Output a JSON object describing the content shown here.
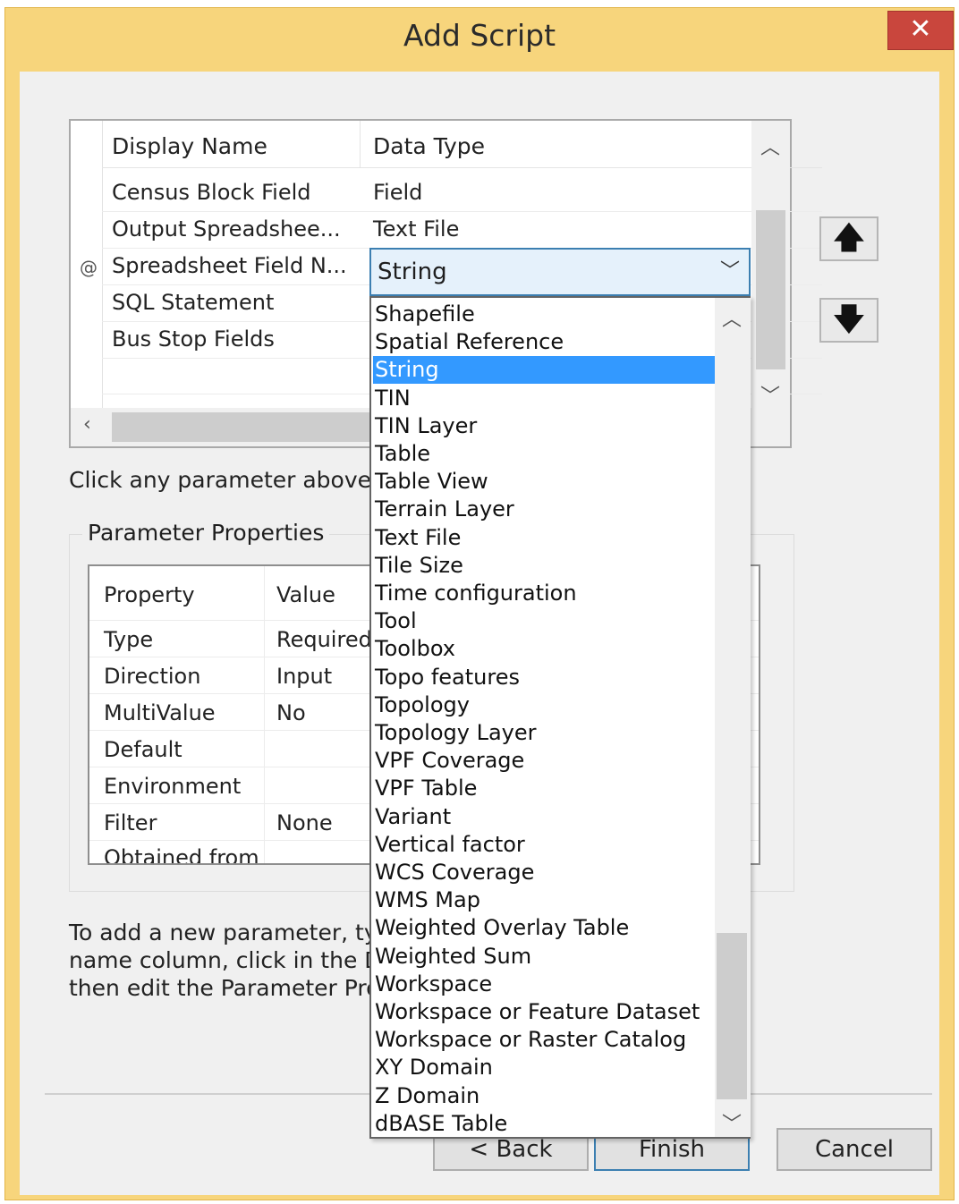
{
  "window": {
    "title": "Add Script",
    "close_glyph": "✕"
  },
  "parameters_grid": {
    "columns": [
      "Display Name",
      "Data Type"
    ],
    "rows": [
      {
        "name": "Census Block Field",
        "type": "Field"
      },
      {
        "name": "Output Spreadshee...",
        "type": "Text File"
      },
      {
        "name": "Spreadsheet Field N...",
        "type": "String",
        "marker": "@"
      },
      {
        "name": "SQL Statement",
        "type": ""
      },
      {
        "name": "Bus Stop Fields",
        "type": ""
      }
    ]
  },
  "move_up_glyph": "🡅",
  "move_down_glyph": "🡇",
  "hint_text": "Click any parameter above to",
  "parameter_properties": {
    "label": "Parameter Properties",
    "columns": [
      "Property",
      "Value"
    ],
    "rows": [
      {
        "property": "Type",
        "value": "Required"
      },
      {
        "property": "Direction",
        "value": "Input"
      },
      {
        "property": "MultiValue",
        "value": "No"
      },
      {
        "property": "Default",
        "value": ""
      },
      {
        "property": "Environment",
        "value": ""
      },
      {
        "property": "Filter",
        "value": "None"
      },
      {
        "property": "Obtained from",
        "value": ""
      }
    ]
  },
  "instructions": {
    "line1": "To add a new parameter, typ",
    "line2": "name column, click in the Data",
    "line3": "then edit the Parameter Prop"
  },
  "combo": {
    "value": "String"
  },
  "dropdown": {
    "selected_index": 2,
    "options": [
      "Shapefile",
      "Spatial Reference",
      "String",
      "TIN",
      "TIN Layer",
      "Table",
      "Table View",
      "Terrain Layer",
      "Text File",
      "Tile Size",
      "Time configuration",
      "Tool",
      "Toolbox",
      "Topo features",
      "Topology",
      "Topology Layer",
      "VPF Coverage",
      "VPF Table",
      "Variant",
      "Vertical factor",
      "WCS Coverage",
      "WMS Map",
      "Weighted Overlay Table",
      "Weighted Sum",
      "Workspace",
      "Workspace or Feature Dataset",
      "Workspace or Raster Catalog",
      "XY Domain",
      "Z Domain",
      "dBASE Table"
    ]
  },
  "buttons": {
    "back": "< Back",
    "finish": "Finish",
    "cancel": "Cancel"
  },
  "colors": {
    "frame": "#f7d57c",
    "close": "#c9463d",
    "selection": "#3399ff",
    "combo_border": "#3c7fb1"
  }
}
